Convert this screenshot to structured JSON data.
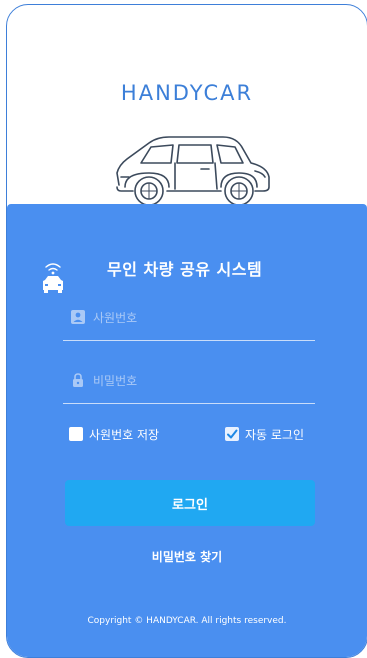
{
  "brand": {
    "name": "HANDYCAR",
    "color": "#3c7fd8"
  },
  "panel": {
    "background": "#4a8ff0",
    "title": "무인 차량 공유 시스템",
    "icons": {
      "system": "car-wifi-icon",
      "user": "user-icon",
      "lock": "lock-icon",
      "check": "checkmark-icon"
    }
  },
  "form": {
    "employee_id_placeholder": "사원번호",
    "password_placeholder": "비밀번호",
    "save_id": {
      "label": "사원번호 저장",
      "checked": false
    },
    "auto_login": {
      "label": "자동 로그인",
      "checked": true
    },
    "login_button": "로그인",
    "find_password": "비밀번호 찾기",
    "button_color": "#20a8f2"
  },
  "footer": {
    "copyright": "Copyright © HANDYCAR. All rights reserved."
  }
}
